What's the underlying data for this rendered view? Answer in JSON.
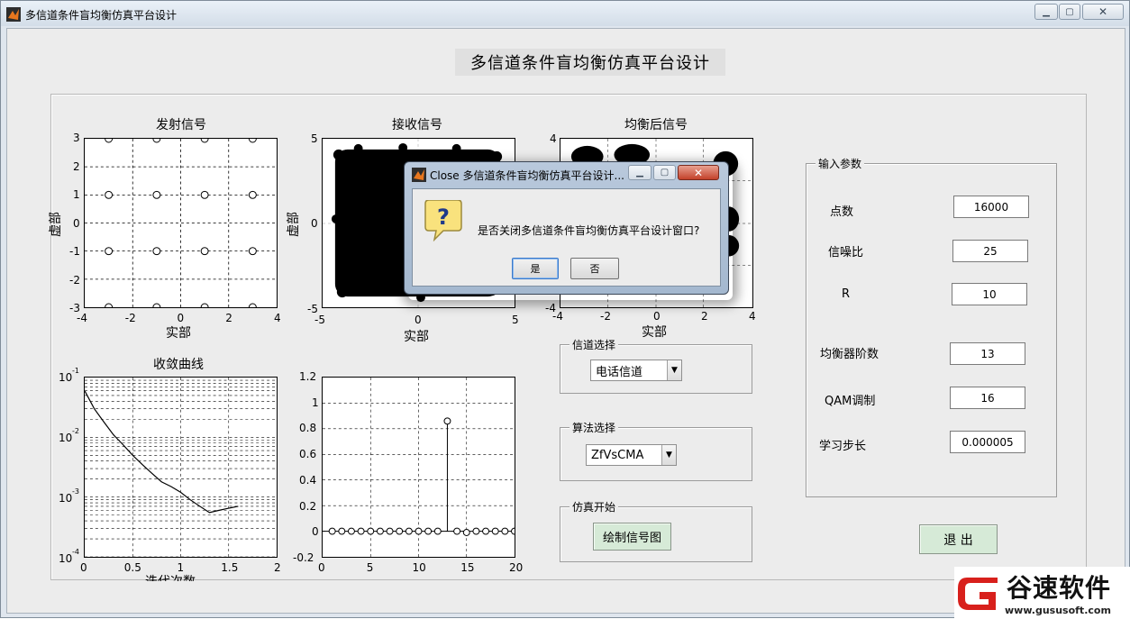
{
  "window": {
    "title": "多信道条件盲均衡仿真平台设计",
    "controls": [
      "minimize",
      "maximize",
      "close"
    ]
  },
  "main_title": "多信道条件盲均衡仿真平台设计",
  "plots": {
    "transmit": {
      "title": "发射信号",
      "xlabel": "实部",
      "ylabel": "虚部",
      "xticks": [
        "-4",
        "-2",
        "0",
        "2",
        "4"
      ],
      "yticks": [
        "3",
        "2",
        "1",
        "0",
        "-1",
        "-2",
        "-3"
      ]
    },
    "receive": {
      "title": "接收信号",
      "xlabel": "实部",
      "ylabel": "虚部",
      "xticks": [
        "-5",
        "0",
        "5"
      ],
      "yticks": [
        "5",
        "0",
        "-5"
      ]
    },
    "equalized": {
      "title": "均衡后信号",
      "xlabel": "实部",
      "xticks": [
        "-4",
        "-2",
        "0",
        "2",
        "4"
      ],
      "yticks": [
        "4",
        "-4"
      ]
    },
    "convergence": {
      "title": "收敛曲线",
      "xlabel": "迭代次数",
      "xticks": [
        "0",
        "0.5",
        "1",
        "1.5",
        "2"
      ],
      "yticks": [
        "10",
        "10",
        "10",
        "10"
      ],
      "yexp": [
        "-1",
        "-2",
        "-3",
        "-4"
      ]
    },
    "stem": {
      "xticks": [
        "0",
        "5",
        "10",
        "15",
        "20"
      ],
      "yticks": [
        "1.2",
        "1",
        "0.8",
        "0.6",
        "0.4",
        "0.2",
        "0",
        "-0.2"
      ]
    }
  },
  "chart_data": [
    {
      "type": "scatter",
      "title": "发射信号",
      "xlabel": "实部",
      "ylabel": "虚部",
      "xlim": [
        -4,
        4
      ],
      "ylim": [
        -3,
        3
      ],
      "grid": true,
      "x": [
        -3,
        -1,
        1,
        3,
        -3,
        -1,
        1,
        3,
        -3,
        -1,
        1,
        3,
        -3,
        -1,
        1,
        3
      ],
      "y": [
        3,
        3,
        3,
        3,
        1,
        1,
        1,
        1,
        -1,
        -1,
        -1,
        -1,
        -3,
        -3,
        -3,
        -3
      ]
    },
    {
      "type": "line",
      "title": "收敛曲线",
      "xlabel": "迭代次数",
      "xlim": [
        0,
        2
      ],
      "ylim": [
        0.0001,
        0.1
      ],
      "yscale": "log",
      "grid": true,
      "x": [
        0,
        0.1,
        0.2,
        0.3,
        0.4,
        0.5,
        0.6,
        0.7,
        0.8,
        0.9,
        1.0,
        1.1,
        1.2,
        1.3,
        1.4,
        1.5,
        1.6
      ],
      "y": [
        0.06,
        0.03,
        0.018,
        0.011,
        0.0075,
        0.005,
        0.0035,
        0.0025,
        0.0018,
        0.0015,
        0.0012,
        0.0009,
        0.0007,
        0.00055,
        0.0006,
        0.00065,
        0.0007
      ]
    },
    {
      "type": "stem",
      "xlim": [
        0,
        20
      ],
      "ylim": [
        -0.2,
        1.2
      ],
      "grid": true,
      "x": [
        1,
        2,
        3,
        4,
        5,
        6,
        7,
        8,
        9,
        10,
        11,
        12,
        13,
        14,
        15,
        16,
        17,
        18,
        19,
        20
      ],
      "y": [
        0,
        0,
        0,
        0,
        0,
        0,
        0,
        0,
        0,
        0,
        0,
        0,
        0.86,
        0,
        -0.01,
        0,
        0,
        0,
        0,
        0
      ]
    }
  ],
  "channel": {
    "group_title": "信道选择",
    "selected": "电话信道"
  },
  "algorithm": {
    "group_title": "算法选择",
    "selected": "ZfVsCMA"
  },
  "sim": {
    "group_title": "仿真开始",
    "button": "绘制信号图"
  },
  "params": {
    "group_title": "输入参数",
    "items": [
      {
        "label": "点数",
        "value": "16000"
      },
      {
        "label": "信噪比",
        "value": "25"
      },
      {
        "label": "R",
        "value": "10"
      },
      {
        "label": "均衡器阶数",
        "value": "13"
      },
      {
        "label": "QAM调制",
        "value": "16"
      },
      {
        "label": "学习步长",
        "value": "0.000005"
      }
    ]
  },
  "exit_button": "退  出",
  "dialog": {
    "title": "Close 多信道条件盲均衡仿真平台设计...",
    "message": "是否关闭多信道条件盲均衡仿真平台设计窗口?",
    "yes": "是",
    "no": "否",
    "icon": "question-icon"
  },
  "watermark": {
    "brand": "谷速软件",
    "url": "www.gususoft.com"
  }
}
